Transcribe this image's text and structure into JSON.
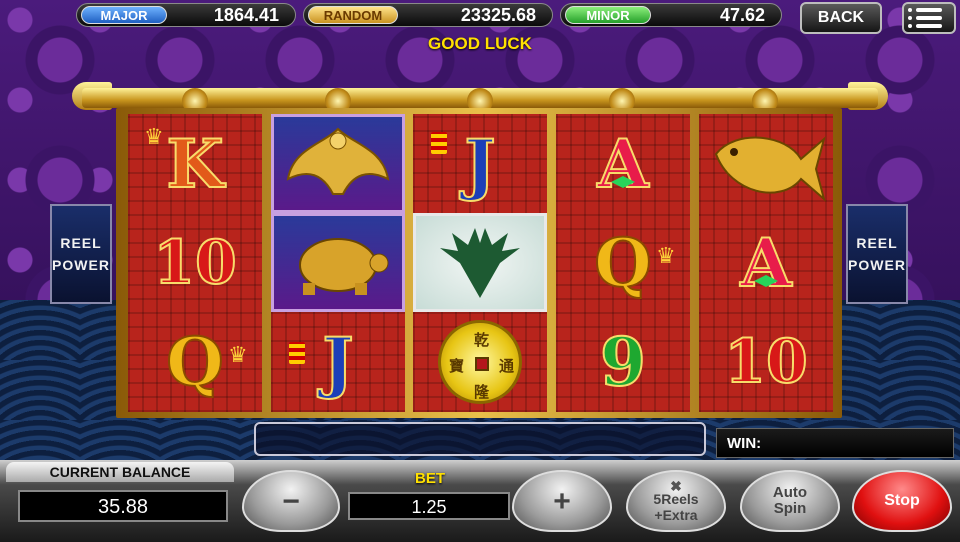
{
  "jackpots": {
    "major": {
      "label": "MAJOR",
      "value": "1864.41"
    },
    "random": {
      "label": "RANDOM",
      "value": "23325.68"
    },
    "minor": {
      "label": "MINOR",
      "value": "47.62"
    }
  },
  "header": {
    "back_label": "BACK",
    "menu_icon": "menu-icon",
    "message": "GOOD LUCK"
  },
  "side_panel": {
    "line1": "REEL",
    "line2": "POWER"
  },
  "reels": [
    {
      "top": "K",
      "middle": "10",
      "bottom": "Q"
    },
    {
      "top": "phoenix",
      "middle": "turtle",
      "bottom": "J"
    },
    {
      "top": "J",
      "middle": "dragon",
      "bottom": "coin"
    },
    {
      "top": "A",
      "middle": "Q",
      "bottom": "9"
    },
    {
      "top": "koi-fish",
      "middle": "A",
      "bottom": "10"
    }
  ],
  "coin_chars": {
    "top": "乾",
    "left": "寶",
    "right": "通",
    "bottom": "隆"
  },
  "win": {
    "label": "WIN:"
  },
  "balance": {
    "label": "CURRENT BALANCE",
    "value": "35.88"
  },
  "bet": {
    "label": "BET",
    "value": "1.25"
  },
  "controls": {
    "minus": "−",
    "plus": "+",
    "five_reels_line1": "5Reels",
    "five_reels_line2": "+Extra",
    "auto_line1": "Auto",
    "auto_line2": "Spin",
    "stop": "Stop"
  },
  "colors": {
    "accent_yellow": "#ffe000",
    "stop_red": "#e01010",
    "reel_red": "#b8241c"
  }
}
